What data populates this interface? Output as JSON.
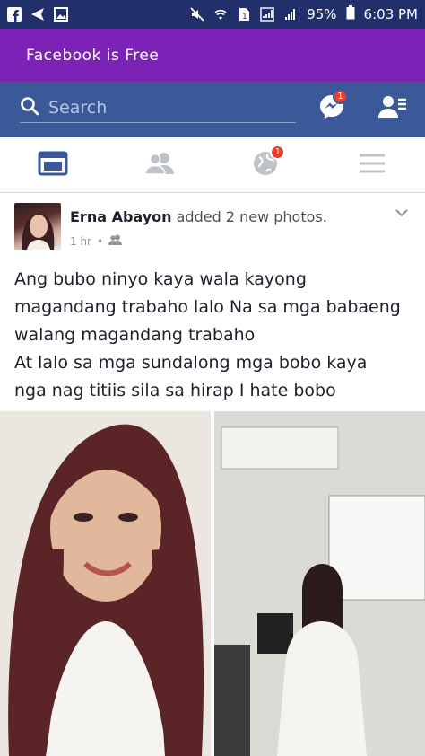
{
  "status_bar": {
    "battery_pct": "95%",
    "time": "6:03 PM",
    "left_icons": [
      "facebook-icon",
      "send-icon",
      "image-icon"
    ],
    "right_icons": [
      "mute-icon",
      "wifi-icon",
      "sim-icon",
      "signal-icon",
      "signal-icon-2"
    ]
  },
  "promo_banner": {
    "text": "Facebook is Free"
  },
  "header": {
    "search_placeholder": "Search",
    "messenger_badge": "1",
    "icons": [
      "search-icon",
      "messenger-icon",
      "friend-requests-icon"
    ]
  },
  "tabs": [
    {
      "name": "news-feed",
      "icon": "news-feed-icon",
      "active": true
    },
    {
      "name": "friends",
      "icon": "friends-icon",
      "active": false
    },
    {
      "name": "notifications",
      "icon": "globe-icon",
      "badge": "1",
      "active": false
    },
    {
      "name": "menu",
      "icon": "menu-icon",
      "active": false
    }
  ],
  "post": {
    "author": "Erna Abayon",
    "action": "added 2 new photos.",
    "time": "1 hr",
    "audience_icon": "friends-audience-icon",
    "text": "Ang bubo ninyo kaya wala kayong\nmagandang trabaho lalo Na sa mga babaeng\nwalang magandang trabaho\nAt lalo sa mga sundalong mga bobo kaya\nnga nag titiis sila sa  hirap I hate bobo",
    "photos": [
      "photo-1",
      "photo-2"
    ]
  },
  "colors": {
    "status_bar": "#21306a",
    "promo": "#7b23b6",
    "fb_blue": "#3b5998",
    "badge": "#e5412f",
    "tab_active": "#3b5998",
    "tab_inactive": "#bec3c9"
  }
}
